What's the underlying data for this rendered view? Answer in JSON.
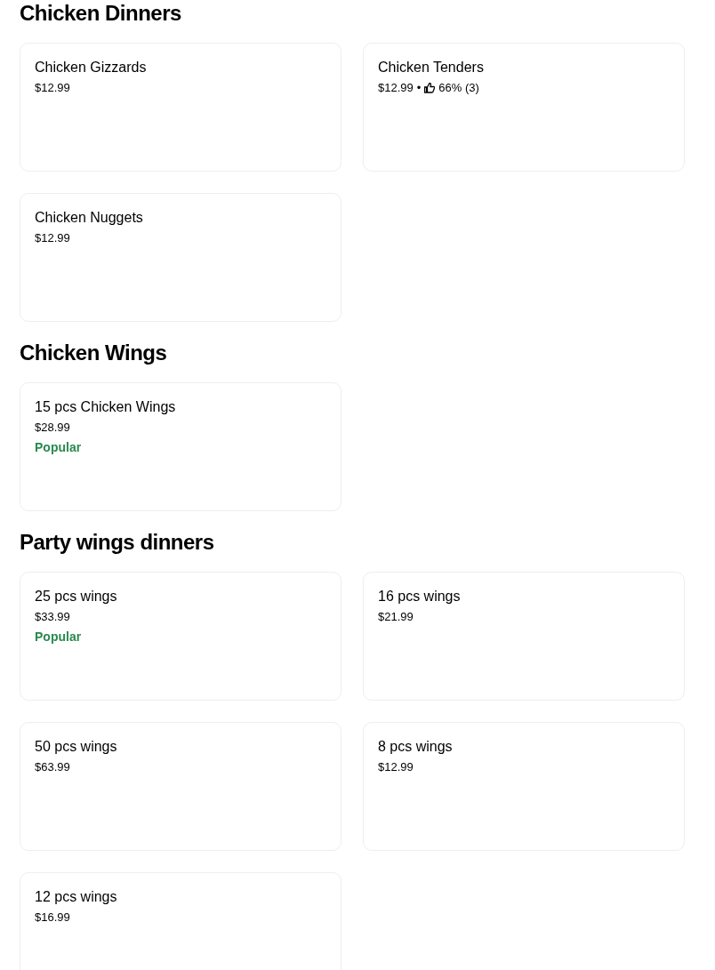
{
  "sections": [
    {
      "title": "Chicken Dinners",
      "items": [
        {
          "name": "Chicken Gizzards",
          "price": "$12.99"
        },
        {
          "name": "Chicken Tenders",
          "price": "$12.99",
          "separator": "•",
          "rating": "66% (3)"
        },
        {
          "name": "Chicken Nuggets",
          "price": "$12.99"
        }
      ]
    },
    {
      "title": "Chicken Wings",
      "items": [
        {
          "name": "15 pcs Chicken Wings",
          "price": "$28.99",
          "badge": "Popular"
        }
      ]
    },
    {
      "title": "Party wings dinners",
      "items": [
        {
          "name": "25 pcs wings",
          "price": "$33.99",
          "badge": "Popular"
        },
        {
          "name": "16 pcs wings",
          "price": "$21.99"
        },
        {
          "name": "50 pcs wings",
          "price": "$63.99"
        },
        {
          "name": "8 pcs wings",
          "price": "$12.99"
        },
        {
          "name": "12 pcs wings",
          "price": "$16.99"
        }
      ]
    }
  ]
}
